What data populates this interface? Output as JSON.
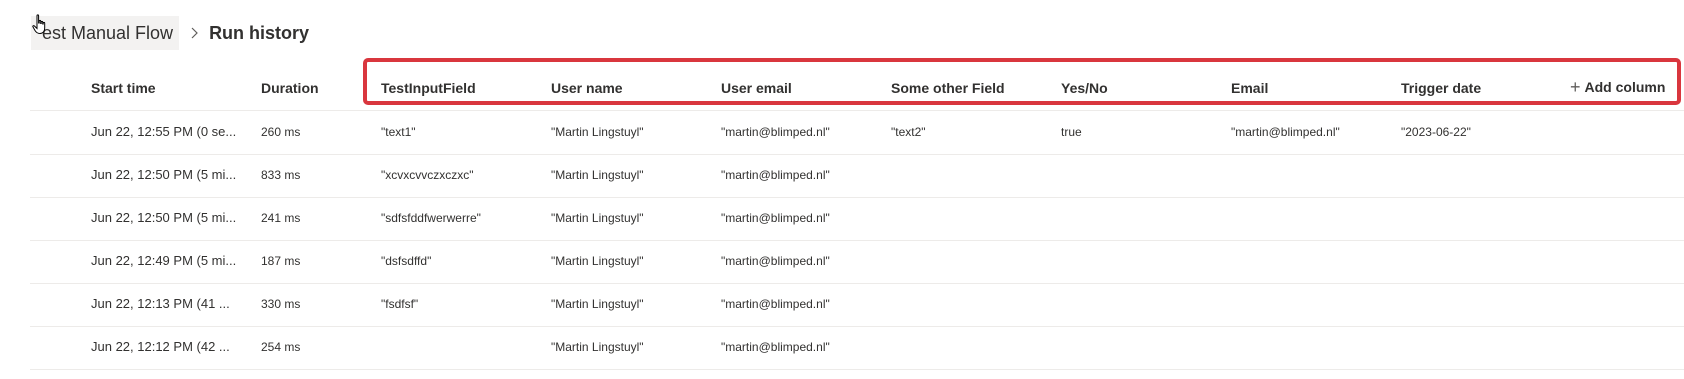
{
  "breadcrumb": {
    "parent": "est Manual Flow",
    "current": "Run history"
  },
  "table": {
    "columns": {
      "start_time": "Start time",
      "duration": "Duration",
      "test_input_field": "TestInputField",
      "user_name": "User name",
      "user_email": "User email",
      "some_other_field": "Some other Field",
      "yes_no": "Yes/No",
      "email": "Email",
      "trigger_date": "Trigger date",
      "add_column": "Add column"
    },
    "rows": [
      {
        "start_time": "Jun 22, 12:55 PM (0 se...",
        "duration": "260 ms",
        "test_input_field": "\"text1\"",
        "user_name": "\"Martin Lingstuyl\"",
        "user_email": "\"martin@blimped.nl\"",
        "some_other_field": "\"text2\"",
        "yes_no": "true",
        "email": "\"martin@blimped.nl\"",
        "trigger_date": "\"2023-06-22\""
      },
      {
        "start_time": "Jun 22, 12:50 PM (5 mi...",
        "duration": "833 ms",
        "test_input_field": "\"xcvxcvvczxczxc\"",
        "user_name": "\"Martin Lingstuyl\"",
        "user_email": "\"martin@blimped.nl\"",
        "some_other_field": "",
        "yes_no": "",
        "email": "",
        "trigger_date": ""
      },
      {
        "start_time": "Jun 22, 12:50 PM (5 mi...",
        "duration": "241 ms",
        "test_input_field": "\"sdfsfddfwerwerre\"",
        "user_name": "\"Martin Lingstuyl\"",
        "user_email": "\"martin@blimped.nl\"",
        "some_other_field": "",
        "yes_no": "",
        "email": "",
        "trigger_date": ""
      },
      {
        "start_time": "Jun 22, 12:49 PM (5 mi...",
        "duration": "187 ms",
        "test_input_field": "\"dsfsdffd\"",
        "user_name": "\"Martin Lingstuyl\"",
        "user_email": "\"martin@blimped.nl\"",
        "some_other_field": "",
        "yes_no": "",
        "email": "",
        "trigger_date": ""
      },
      {
        "start_time": "Jun 22, 12:13 PM (41 ...",
        "duration": "330 ms",
        "test_input_field": "\"fsdfsf\"",
        "user_name": "\"Martin Lingstuyl\"",
        "user_email": "\"martin@blimped.nl\"",
        "some_other_field": "",
        "yes_no": "",
        "email": "",
        "trigger_date": ""
      },
      {
        "start_time": "Jun 22, 12:12 PM (42 ...",
        "duration": "254 ms",
        "test_input_field": "",
        "user_name": "\"Martin Lingstuyl\"",
        "user_email": "\"martin@blimped.nl\"",
        "some_other_field": "",
        "yes_no": "",
        "email": "",
        "trigger_date": ""
      }
    ]
  },
  "colors": {
    "highlight_border": "#d9363e",
    "row_divider": "#edebe9",
    "breadcrumb_hover": "#f3f2f1"
  },
  "icons": {
    "breadcrumb_separator": "chevron-right-icon",
    "add_column": "plus-icon",
    "cursor": "hand-pointer-icon"
  }
}
